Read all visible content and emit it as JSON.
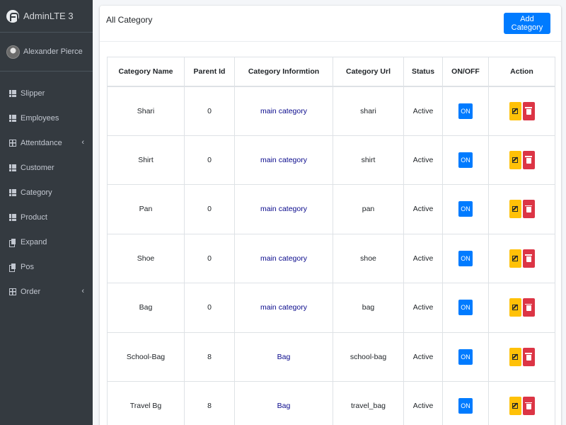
{
  "brand": {
    "name": "AdminLTE 3"
  },
  "user": {
    "name": "Alexander Pierce"
  },
  "sidebar": {
    "items": [
      {
        "label": "Slipper",
        "icon": "grid-icon"
      },
      {
        "label": "Employees",
        "icon": "grid-icon"
      },
      {
        "label": "Attentdance",
        "icon": "table-icon",
        "arrow": "‹"
      },
      {
        "label": "Customer",
        "icon": "grid-icon"
      },
      {
        "label": "Category",
        "icon": "grid-icon"
      },
      {
        "label": "Product",
        "icon": "grid-icon"
      },
      {
        "label": "Expand",
        "icon": "copy-icon"
      },
      {
        "label": "Pos",
        "icon": "copy-icon"
      },
      {
        "label": "Order",
        "icon": "table-icon",
        "arrow": "‹"
      }
    ]
  },
  "card": {
    "title": "All Category",
    "add_label": "Add Category"
  },
  "table": {
    "headers": [
      "Category Name",
      "Parent Id",
      "Category Informtion",
      "Category Url",
      "Status",
      "ON/OFF",
      "Action"
    ],
    "rows": [
      {
        "name": "Shari",
        "parent": "0",
        "info": "main category",
        "url": "shari",
        "status": "Active",
        "toggle": "ON"
      },
      {
        "name": "Shirt",
        "parent": "0",
        "info": "main category",
        "url": "shirt",
        "status": "Active",
        "toggle": "ON"
      },
      {
        "name": "Pan",
        "parent": "0",
        "info": "main category",
        "url": "pan",
        "status": "Active",
        "toggle": "ON"
      },
      {
        "name": "Shoe",
        "parent": "0",
        "info": "main category",
        "url": "shoe",
        "status": "Active",
        "toggle": "ON"
      },
      {
        "name": "Bag",
        "parent": "0",
        "info": "main category",
        "url": "bag",
        "status": "Active",
        "toggle": "ON"
      },
      {
        "name": "School-Bag",
        "parent": "8",
        "info": "Bag",
        "url": "school-bag",
        "status": "Active",
        "toggle": "ON"
      },
      {
        "name": "Travel Bg",
        "parent": "8",
        "info": "Bag",
        "url": "travel_bag",
        "status": "Active",
        "toggle": "ON"
      }
    ]
  },
  "colors": {
    "sidebar_bg": "#343a40",
    "primary": "#007bff",
    "warning": "#ffc107",
    "danger": "#dc3545"
  }
}
